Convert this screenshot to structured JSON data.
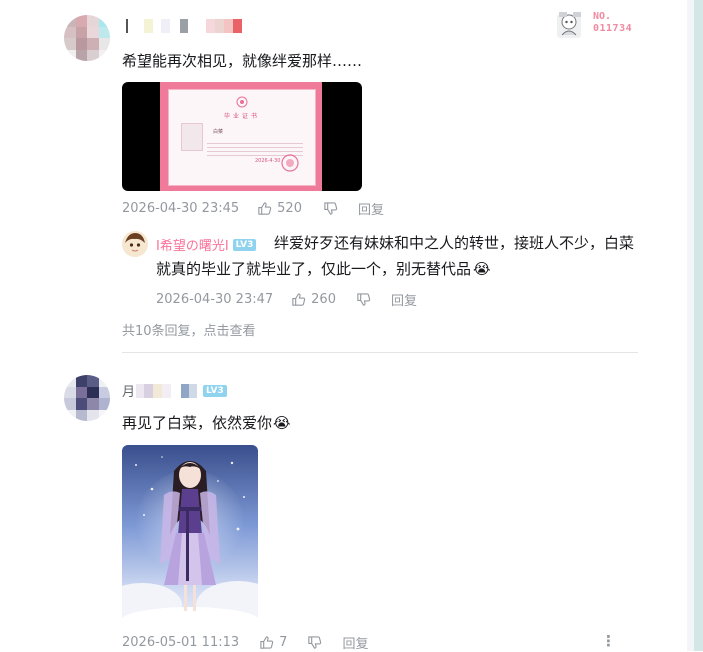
{
  "comments": [
    {
      "text": "希望能再次相见，就像绊爱那样……",
      "date": "2026-04-30 23:45",
      "likes": "520",
      "reply_label": "回复",
      "badge": {
        "label": "NO.",
        "number": "011734"
      },
      "image": {
        "title": "毕业证书",
        "inner_name": "白菜",
        "stamp": "2026·4·30"
      }
    },
    {
      "text": "再见了白菜，依然爱你",
      "emoji": "😭",
      "level": "LV3",
      "partial_name": "月",
      "date": "2026-05-01 11:13",
      "likes": "7",
      "reply_label": "回复",
      "more": "⋮"
    }
  ],
  "reply": {
    "username": "I希望の曙光I",
    "level": "LV3",
    "line1": "绊爱好歹还有妹妹和中之人的转世，接班人不少，白菜",
    "line2": "就真的毕业了就毕业了，仅此一个，别无替代品",
    "emoji": "😭",
    "date": "2026-04-30 23:47",
    "likes": "260",
    "reply_label": "回复"
  },
  "more_replies": "共10条回复，点击查看",
  "colors": {
    "accent": "#fb7299",
    "meta": "#9499a0",
    "level": "#8fd3ef"
  }
}
